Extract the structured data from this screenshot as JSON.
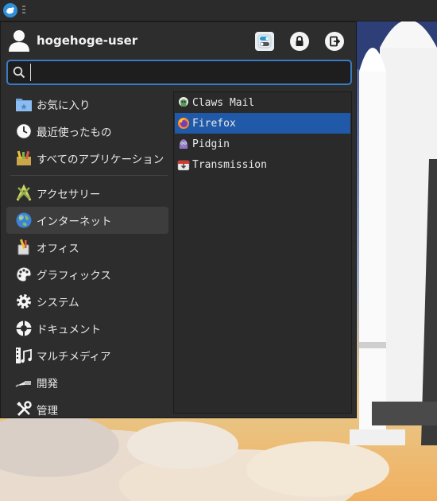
{
  "user": {
    "name": "hogehoge-user"
  },
  "search": {
    "value": "",
    "placeholder": ""
  },
  "actions": [
    {
      "name": "settings-button",
      "icon": "settings-toggle-icon"
    },
    {
      "name": "lock-screen-button",
      "icon": "lock-icon"
    },
    {
      "name": "logout-button",
      "icon": "logout-icon"
    }
  ],
  "categories": [
    {
      "label": "お気に入り",
      "icon": "favorites-folder-icon"
    },
    {
      "label": "最近使ったもの",
      "icon": "clock-icon"
    },
    {
      "label": "すべてのアプリケーション",
      "icon": "all-apps-icon"
    },
    {
      "label": "アクセサリー",
      "icon": "accessories-icon"
    },
    {
      "label": "インターネット",
      "icon": "internet-globe-icon",
      "selected": true
    },
    {
      "label": "オフィス",
      "icon": "office-icon"
    },
    {
      "label": "グラフィックス",
      "icon": "graphics-palette-icon"
    },
    {
      "label": "システム",
      "icon": "system-gear-icon"
    },
    {
      "label": "ドキュメント",
      "icon": "documents-help-icon"
    },
    {
      "label": "マルチメディア",
      "icon": "multimedia-icon"
    },
    {
      "label": "開発",
      "icon": "development-icon"
    },
    {
      "label": "管理",
      "icon": "admin-tools-icon"
    }
  ],
  "apps": [
    {
      "label": "Claws Mail",
      "icon": "claws-mail-icon"
    },
    {
      "label": "Firefox",
      "icon": "firefox-icon",
      "selected": true
    },
    {
      "label": "Pidgin",
      "icon": "pidgin-icon"
    },
    {
      "label": "Transmission",
      "icon": "transmission-icon"
    }
  ],
  "colors": {
    "accent": "#2059a8",
    "search_border": "#3a7cc4",
    "menu_bg": "#2d2d2d"
  }
}
